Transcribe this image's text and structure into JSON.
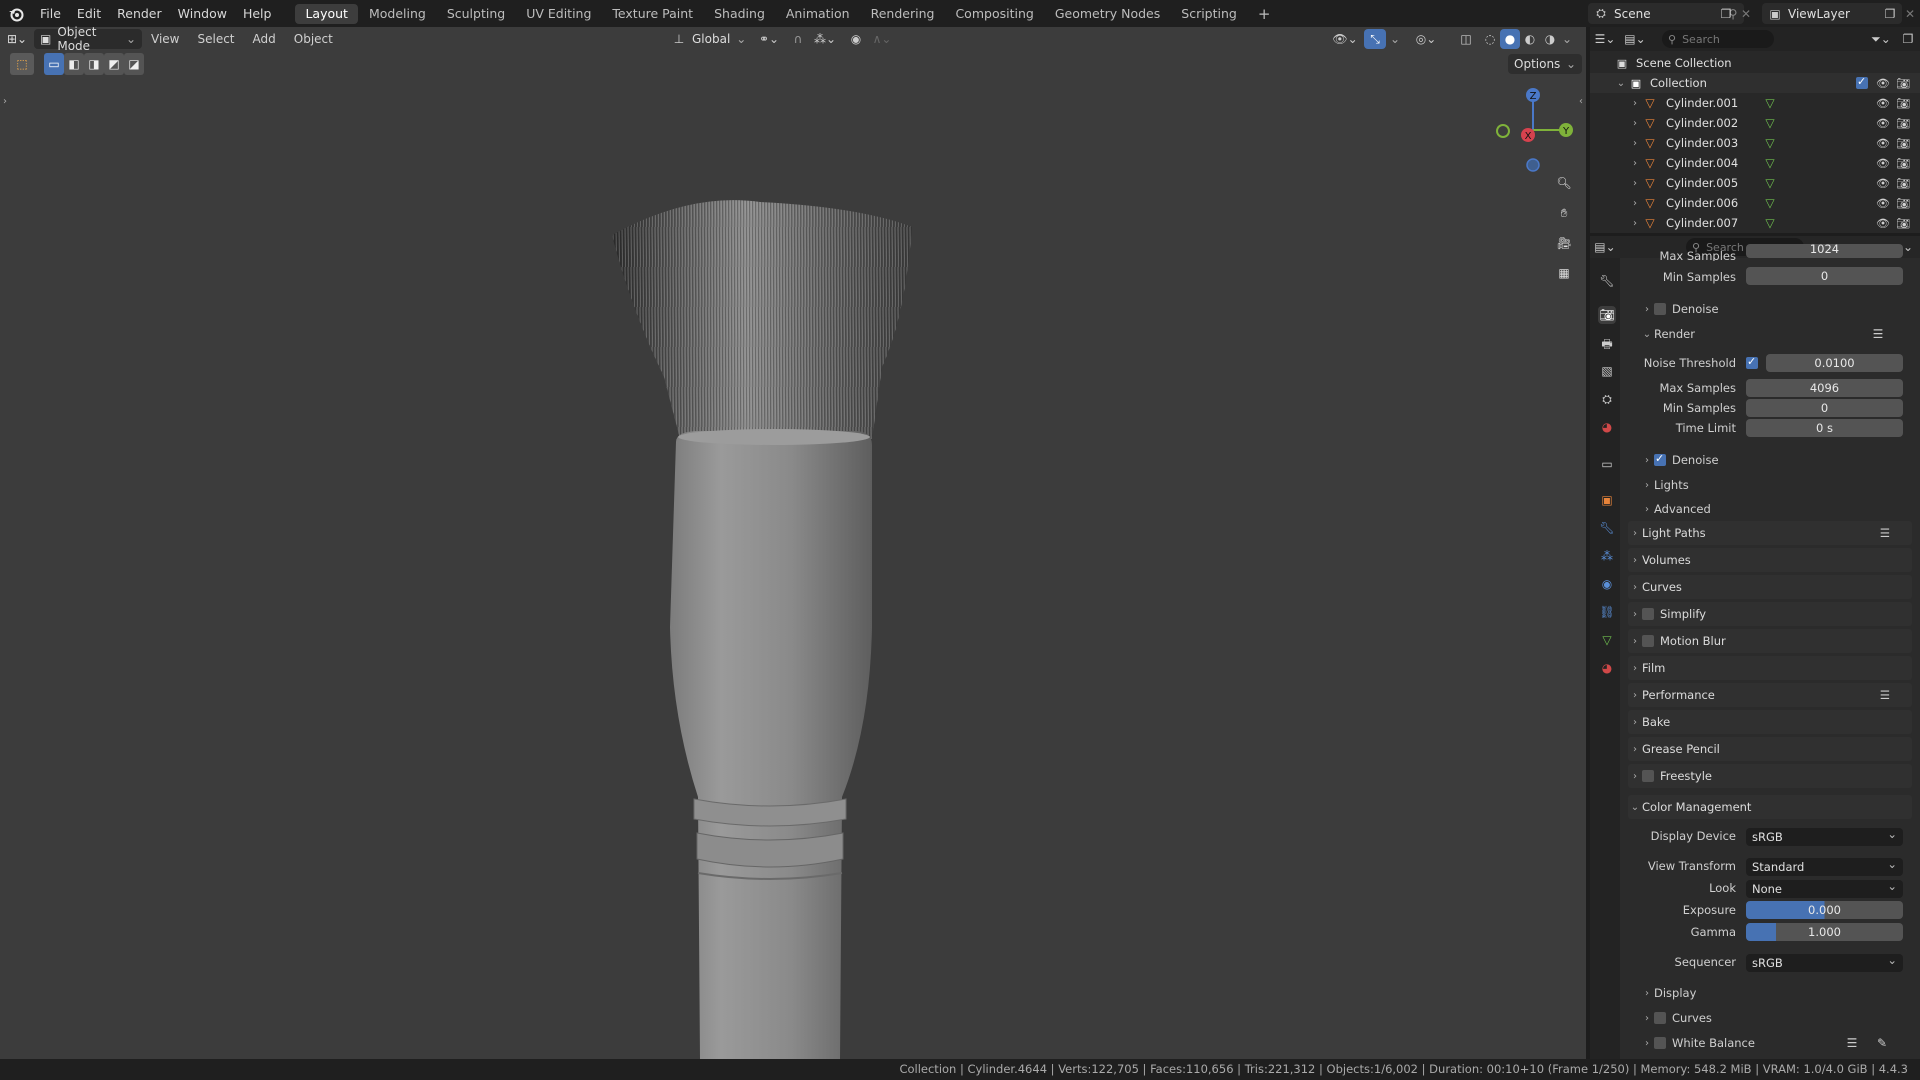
{
  "topbar": {
    "menus": [
      "File",
      "Edit",
      "Render",
      "Window",
      "Help"
    ],
    "workspaces": [
      "Layout",
      "Modeling",
      "Sculpting",
      "UV Editing",
      "Texture Paint",
      "Shading",
      "Animation",
      "Rendering",
      "Compositing",
      "Geometry Nodes",
      "Scripting"
    ],
    "active_workspace": "Layout",
    "add_tab": "+",
    "scene_label": "Scene",
    "viewlayer_label": "ViewLayer"
  },
  "viewport": {
    "mode": "Object Mode",
    "menus": [
      "View",
      "Select",
      "Add",
      "Object"
    ],
    "orientation": "Global",
    "options_label": "Options",
    "gizmo": {
      "z": "Z",
      "x": "X",
      "y": "Y"
    }
  },
  "outliner": {
    "search_placeholder": "Search",
    "scene_collection": "Scene Collection",
    "collection": "Collection",
    "objects": [
      "Cylinder.001",
      "Cylinder.002",
      "Cylinder.003",
      "Cylinder.004",
      "Cylinder.005",
      "Cylinder.006",
      "Cylinder.007"
    ]
  },
  "properties": {
    "search_placeholder": "Search",
    "cut_row": {
      "label": "Max Samples",
      "value": "1024"
    },
    "top_min_samples": {
      "label": "Min Samples",
      "value": "0"
    },
    "denoise_top": "Denoise",
    "render_section": "Render",
    "noise_threshold": {
      "label": "Noise Threshold",
      "value": "0.0100"
    },
    "max_samples": {
      "label": "Max Samples",
      "value": "4096"
    },
    "min_samples": {
      "label": "Min Samples",
      "value": "0"
    },
    "time_limit": {
      "label": "Time Limit",
      "value": "0 s"
    },
    "denoise": "Denoise",
    "lights": "Lights",
    "advanced": "Advanced",
    "panels": [
      "Light Paths",
      "Volumes",
      "Curves",
      "Simplify",
      "Motion Blur",
      "Film",
      "Performance",
      "Bake",
      "Grease Pencil",
      "Freestyle"
    ],
    "color_management": "Color Management",
    "display_device": {
      "label": "Display Device",
      "value": "sRGB"
    },
    "view_transform": {
      "label": "View Transform",
      "value": "Standard"
    },
    "look": {
      "label": "Look",
      "value": "None"
    },
    "exposure": {
      "label": "Exposure",
      "value": "0.000"
    },
    "gamma": {
      "label": "Gamma",
      "value": "1.000"
    },
    "sequencer": {
      "label": "Sequencer",
      "value": "sRGB"
    },
    "cm_subs": [
      "Display",
      "Curves",
      "White Balance"
    ]
  },
  "statusbar": {
    "text": "Collection | Cylinder.4644 | Verts:122,705 | Faces:110,656 | Tris:221,312 | Objects:1/6,002 | Duration: 00:10+10 (Frame 1/250) | Memory: 548.2 MiB | VRAM: 1.0/4.0 GiB | 4.4.3"
  },
  "colors": {
    "accent": "#4772b3",
    "orange": "#e8843a",
    "green": "#6fbf4f"
  }
}
